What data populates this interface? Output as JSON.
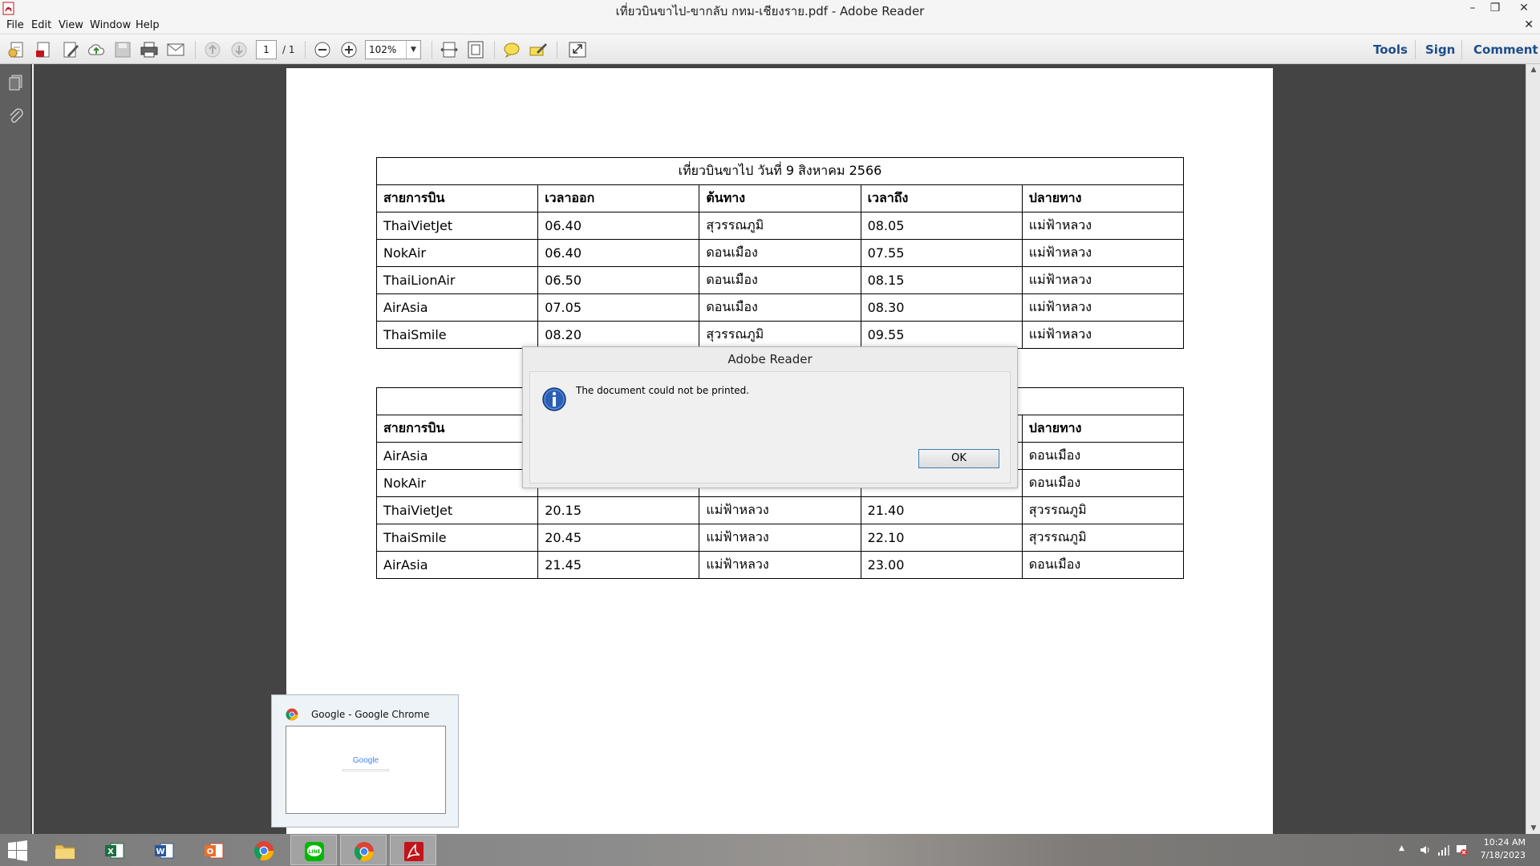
{
  "window": {
    "title": "เที่ยวบินขาไป-ขากลับ กทม-เชียงราย.pdf - Adobe Reader",
    "minimize": "–",
    "restore": "❐",
    "close": "✕"
  },
  "menu": {
    "items": [
      "File",
      "Edit",
      "View",
      "Window",
      "Help"
    ],
    "close_doc": "✕"
  },
  "toolbar": {
    "page_current": "1",
    "page_total": "/ 1",
    "zoom": "102%",
    "tools_label": "Tools",
    "sign_label": "Sign",
    "comment_label": "Comment"
  },
  "document": {
    "outbound": {
      "caption": "เที่ยวบินขาไป วันที่ 9 สิงหาคม 2566",
      "headers": [
        "สายการบิน",
        "เวลาออก",
        "ต้นทาง",
        "เวลาถึง",
        "ปลายทาง"
      ],
      "rows": [
        [
          "ThaiVietJet",
          "06.40",
          "สุวรรณภูมิ",
          "08.05",
          "แม่ฟ้าหลวง"
        ],
        [
          "NokAir",
          "06.40",
          "ดอนเมือง",
          "07.55",
          "แม่ฟ้าหลวง"
        ],
        [
          "ThaiLionAir",
          "06.50",
          "ดอนเมือง",
          "08.15",
          "แม่ฟ้าหลวง"
        ],
        [
          "AirAsia",
          "07.05",
          "ดอนเมือง",
          "08.30",
          "แม่ฟ้าหลวง"
        ],
        [
          "ThaiSmile",
          "08.20",
          "สุวรรณภูมิ",
          "09.55",
          "แม่ฟ้าหลวง"
        ]
      ]
    },
    "return": {
      "caption": "",
      "headers": [
        "สายการบิน",
        "",
        "",
        "",
        "ปลายทาง"
      ],
      "rows": [
        [
          "AirAsia",
          "",
          "",
          "",
          "ดอนเมือง"
        ],
        [
          "NokAir",
          "",
          "",
          "",
          "ดอนเมือง"
        ],
        [
          "ThaiVietJet",
          "20.15",
          "แม่ฟ้าหลวง",
          "21.40",
          "สุวรรณภูมิ"
        ],
        [
          "ThaiSmile",
          "20.45",
          "แม่ฟ้าหลวง",
          "22.10",
          "สุวรรณภูมิ"
        ],
        [
          "AirAsia",
          "21.45",
          "แม่ฟ้าหลวง",
          "23.00",
          "ดอนเมือง"
        ]
      ]
    }
  },
  "dialog": {
    "title": "Adobe Reader",
    "message": "The document could not be printed.",
    "ok_label": "OK"
  },
  "thumbnail": {
    "title": "Google - Google Chrome",
    "preview_logo": "Google"
  },
  "taskbar": {
    "apps": [
      "file-explorer",
      "excel",
      "word",
      "outlook",
      "chrome",
      "line",
      "chrome",
      "adobe-reader"
    ],
    "time": "10:24 AM",
    "date": "7/18/2023"
  },
  "colors": {
    "accent": "#1e4d8a",
    "workarea": "#444444",
    "adobe_red": "#c4141b"
  }
}
